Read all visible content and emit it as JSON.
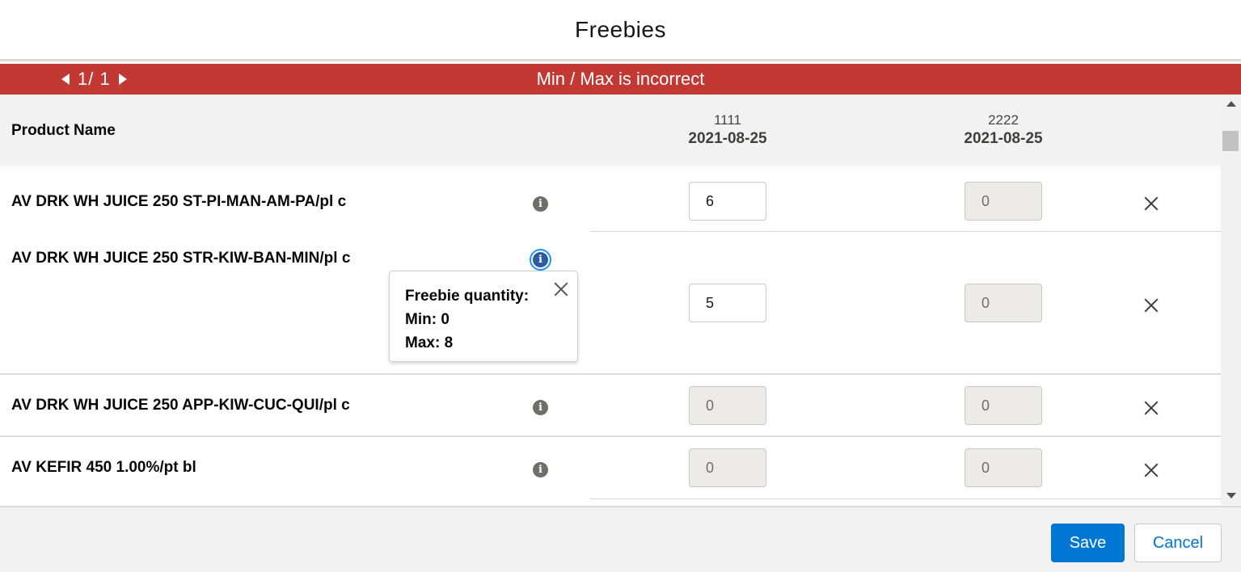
{
  "modal": {
    "title": "Freebies"
  },
  "error_bar": {
    "page_text": "1/ 1",
    "message": "Min / Max is incorrect",
    "color": "#c23934"
  },
  "table": {
    "header": {
      "product_name": "Product Name",
      "columns": [
        {
          "code": "1111",
          "date": "2021-08-25"
        },
        {
          "code": "2222",
          "date": "2021-08-25"
        }
      ]
    },
    "rows": [
      {
        "name": "AV DRK WH JUICE 250 ST-PI-MAN-AM-PA/pl c",
        "qty1": "6",
        "qty2": "0"
      },
      {
        "name": "AV DRK WH JUICE 250 STR-KIW-BAN-MIN/pl c",
        "qty1": "5",
        "qty2": "0"
      },
      {
        "name": "AV DRK WH JUICE 250 APP-KIW-CUC-QUI/pl c",
        "qty1": "0",
        "qty2": "0"
      },
      {
        "name": "AV KEFIR 450 1.00%/pt bl",
        "qty1": "0",
        "qty2": "0"
      }
    ]
  },
  "popover": {
    "title": "Freebie quantity:",
    "min": "Min: 0",
    "max": "Max: 8"
  },
  "footer": {
    "save": "Save",
    "cancel": "Cancel"
  },
  "icons": {
    "info": "info-icon",
    "remove": "close-icon",
    "prev": "caret-left-icon",
    "next": "caret-right-icon"
  },
  "colors": {
    "brand": "#0176d3",
    "error": "#c23934"
  }
}
